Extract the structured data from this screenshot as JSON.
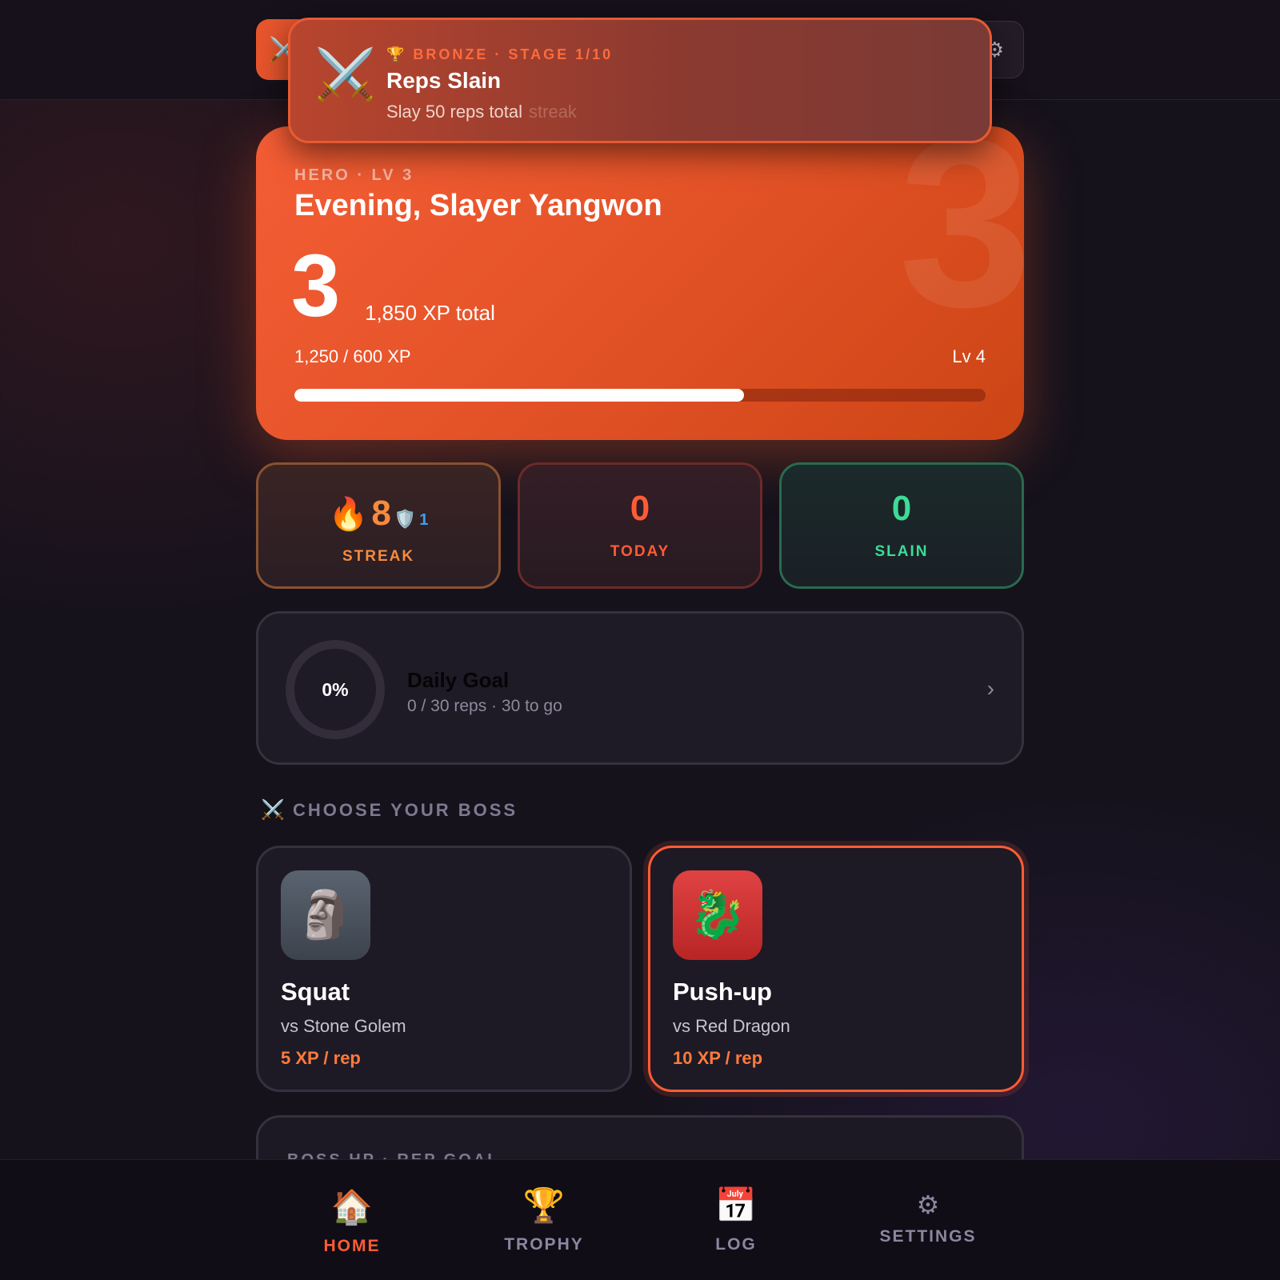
{
  "topbar": {
    "logo_icon": "⚔️",
    "gear_icon": "⚙"
  },
  "toast": {
    "icon": "⚔️",
    "tag": "🏆 BRONZE · STAGE 1/10",
    "title": "Reps Slain",
    "subtitle": "Slay 50 reps total",
    "ghost_text": "streak"
  },
  "hero": {
    "tag": "HERO · LV 3",
    "greeting": "Evening, Slayer Yangwon",
    "level": "3",
    "watermark": "3",
    "xp_total": "1,850 XP total",
    "progress_text": "1,250 / 600 XP",
    "next_level": "Lv 4",
    "progress_fraction": 0.65
  },
  "stats": {
    "streak": {
      "icon": "🔥",
      "value": "8",
      "shield_icon": "🛡️",
      "shields": "1",
      "label": "STREAK"
    },
    "today": {
      "value": "0",
      "label": "TODAY"
    },
    "slain": {
      "value": "0",
      "label": "SLAIN"
    }
  },
  "daily_goal": {
    "percent": "0%",
    "title": "Daily Goal",
    "subtitle": "0 / 30 reps · 30 to go",
    "chevron": "›"
  },
  "bosses_section": {
    "icon": "⚔️",
    "title": "CHOOSE YOUR BOSS",
    "items": [
      {
        "icon": "🗿",
        "name": "Squat",
        "vs": "vs Stone Golem",
        "xp": "5 XP / rep",
        "selected": false
      },
      {
        "icon": "🐉",
        "name": "Push-up",
        "vs": "vs Red Dragon",
        "xp": "10 XP / rep",
        "selected": true
      }
    ]
  },
  "boss_hp": {
    "label": "BOSS HP · REP GOAL"
  },
  "nav": {
    "items": [
      {
        "icon": "🏠",
        "label": "HOME",
        "active": true
      },
      {
        "icon": "🏆",
        "label": "TROPHY",
        "active": false
      },
      {
        "icon": "📅",
        "label": "LOG",
        "active": false
      },
      {
        "icon": "⚙",
        "label": "SETTINGS",
        "active": false
      }
    ]
  },
  "colors": {
    "accent": "#ff5c35",
    "hero_gradient_start": "#f45d35",
    "hero_gradient_end": "#cc4515",
    "streak": "#f78a3d",
    "today": "#ff5c35",
    "slain": "#3ddc97",
    "background": "#15121c"
  }
}
